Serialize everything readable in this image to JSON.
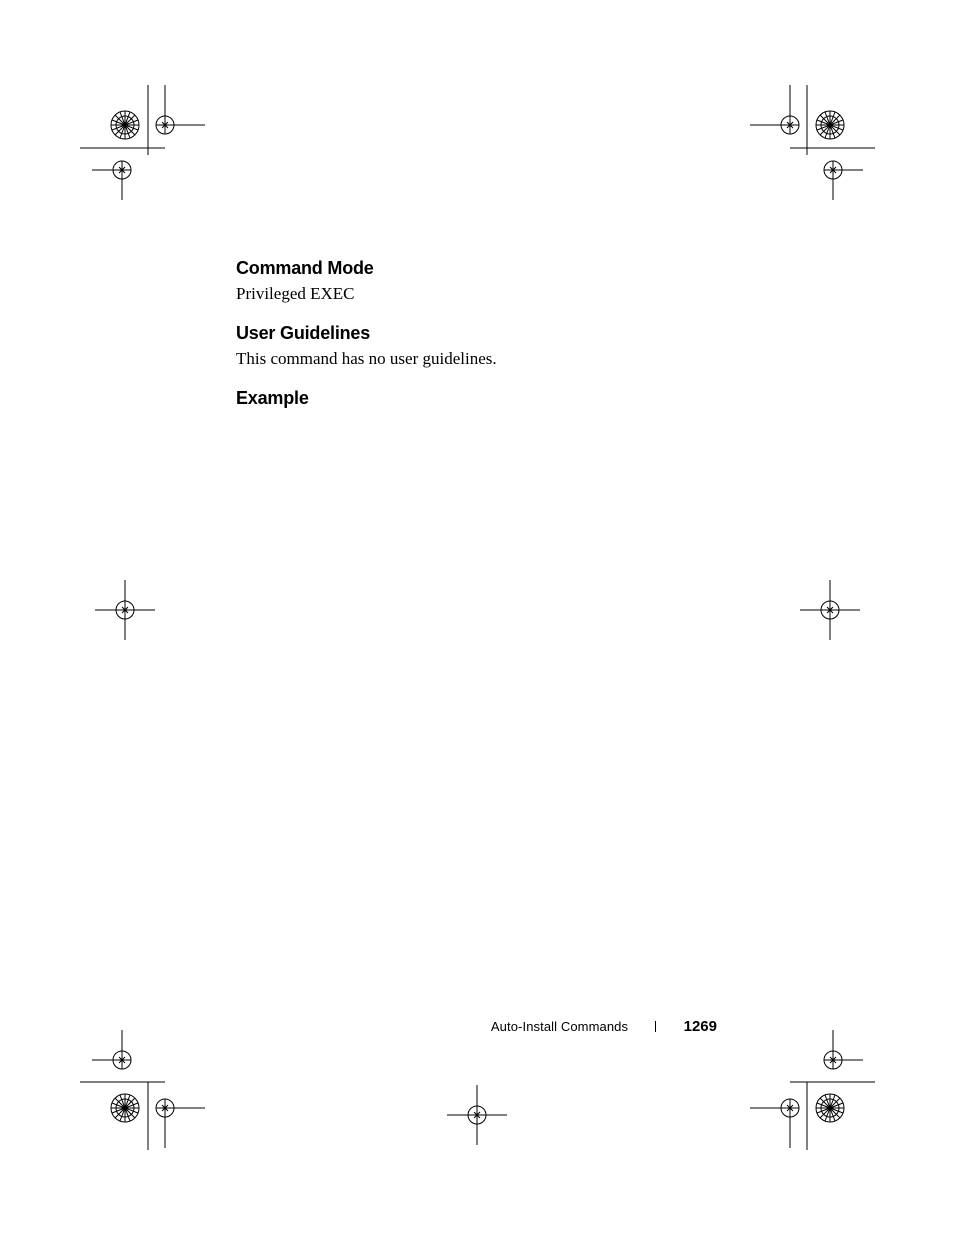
{
  "headings": {
    "command_mode": "Command Mode",
    "user_guidelines": "User Guidelines",
    "example": "Example"
  },
  "body": {
    "command_mode_text": "Privileged EXEC",
    "user_guidelines_text": "This command has no user guidelines."
  },
  "footer": {
    "section": "Auto-Install Commands",
    "page": "1269"
  }
}
